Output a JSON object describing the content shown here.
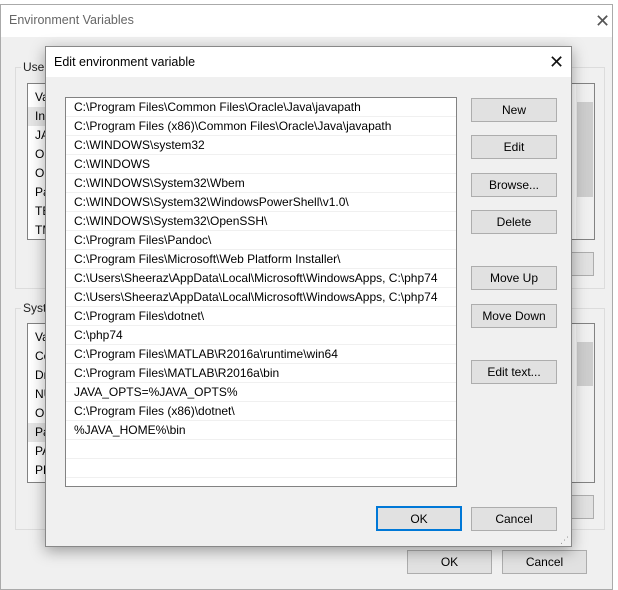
{
  "outer": {
    "title": "Environment Variables",
    "user_group": "User",
    "user_rows": [
      "Va",
      "Inf",
      "JA",
      "Or",
      "Or",
      "Pa",
      "TE",
      "TM"
    ],
    "system_group": "Syste",
    "system_rows": [
      "Va",
      "Co",
      "Dr",
      "NU",
      "OS",
      "Pa",
      "PA",
      "PR"
    ],
    "ok": "OK",
    "cancel": "Cancel"
  },
  "dialog": {
    "title": "Edit environment variable",
    "paths": [
      "C:\\Program Files\\Common Files\\Oracle\\Java\\javapath",
      "C:\\Program Files (x86)\\Common Files\\Oracle\\Java\\javapath",
      "C:\\WINDOWS\\system32",
      "C:\\WINDOWS",
      "C:\\WINDOWS\\System32\\Wbem",
      "C:\\WINDOWS\\System32\\WindowsPowerShell\\v1.0\\",
      "C:\\WINDOWS\\System32\\OpenSSH\\",
      "C:\\Program Files\\Pandoc\\",
      "C:\\Program Files\\Microsoft\\Web Platform Installer\\",
      "C:\\Users\\Sheeraz\\AppData\\Local\\Microsoft\\WindowsApps, C:\\php74",
      "C:\\Users\\Sheeraz\\AppData\\Local\\Microsoft\\WindowsApps, C:\\php74",
      "C:\\Program Files\\dotnet\\",
      "C:\\php74",
      "C:\\Program Files\\MATLAB\\R2016a\\runtime\\win64",
      "C:\\Program Files\\MATLAB\\R2016a\\bin",
      "JAVA_OPTS=%JAVA_OPTS%",
      "C:\\Program Files (x86)\\dotnet\\",
      "%JAVA_HOME%\\bin",
      "",
      "",
      ""
    ],
    "buttons": {
      "new": "New",
      "edit": "Edit",
      "browse": "Browse...",
      "delete": "Delete",
      "move_up": "Move Up",
      "move_down": "Move Down",
      "edit_text": "Edit text..."
    },
    "ok": "OK",
    "cancel": "Cancel"
  },
  "colors": {
    "accent": "#0078d7"
  }
}
